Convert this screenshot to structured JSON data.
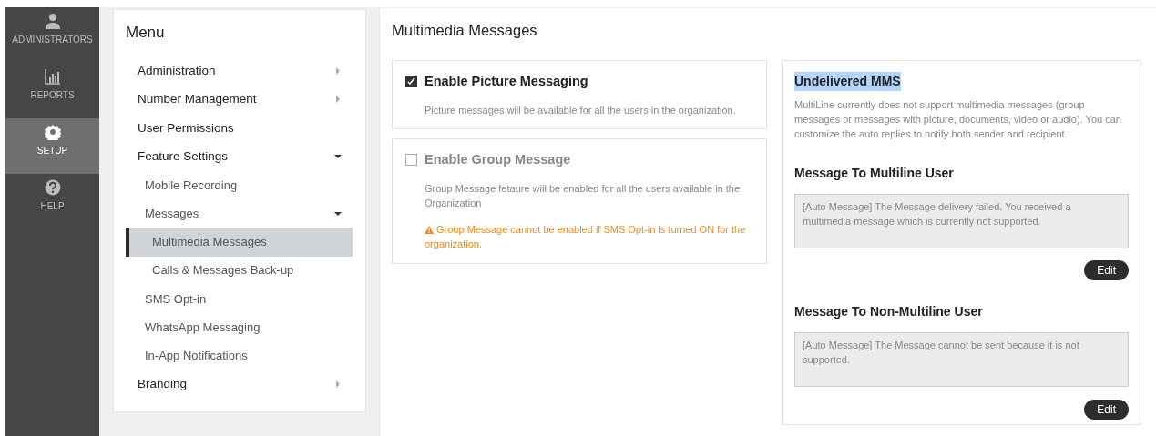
{
  "nav": [
    {
      "label": "ADMINISTRATORS",
      "selected": false
    },
    {
      "label": "REPORTS",
      "selected": false
    },
    {
      "label": "SETUP",
      "selected": true
    },
    {
      "label": "HELP",
      "selected": false
    }
  ],
  "menu": {
    "title": "Menu",
    "items": [
      {
        "label": "Administration",
        "kind": "group",
        "expanded": false,
        "selected": false
      },
      {
        "label": "Number Management",
        "kind": "group",
        "expanded": false,
        "selected": false
      },
      {
        "label": "User Permissions",
        "kind": "link",
        "selected": false
      },
      {
        "label": "Feature Settings",
        "kind": "group",
        "expanded": true,
        "selected": false,
        "children": [
          {
            "label": "Mobile Recording",
            "kind": "link",
            "selected": false
          },
          {
            "label": "Messages",
            "kind": "group",
            "expanded": true,
            "selected": false,
            "children": [
              {
                "label": "Multimedia Messages",
                "kind": "link",
                "selected": true
              },
              {
                "label": "Calls & Messages Back-up",
                "kind": "link",
                "selected": false
              }
            ]
          },
          {
            "label": "SMS Opt-in",
            "kind": "link",
            "selected": false
          },
          {
            "label": "WhatsApp Messaging",
            "kind": "link",
            "selected": false
          },
          {
            "label": "In-App Notifications",
            "kind": "link",
            "selected": false
          }
        ]
      },
      {
        "label": "Branding",
        "kind": "group",
        "expanded": false,
        "selected": false
      }
    ]
  },
  "page_title": "Multimedia Messages",
  "options": [
    {
      "label": "Enable Picture Messaging",
      "checked": true,
      "disabled": false,
      "description": "Picture messages will be available for all the users in the organization."
    },
    {
      "label": "Enable Group Message",
      "checked": false,
      "disabled": true,
      "description": "Group Message fetaure will be enabled for all the users available in the Organization",
      "warning": "Group Message cannot be enabled if SMS Opt-in is turned ON for the organization."
    }
  ],
  "undelivered": {
    "title": "Undelivered MMS",
    "highlighted": true,
    "description": "MultiLine currently does not support multimedia messages (group messages or messages with picture, documents, video or audio). You can customize the auto replies to notify both sender and recipient.",
    "messages": [
      {
        "heading": "Message To Multiline User",
        "value": "[Auto Message] The Message delivery failed. You received a multimedia message which is currently not supported.",
        "button": "Edit"
      },
      {
        "heading": "Message To Non-Multiline User",
        "value": "[Auto Message] The Message cannot be sent because it is not supported.",
        "button": "Edit"
      }
    ]
  }
}
